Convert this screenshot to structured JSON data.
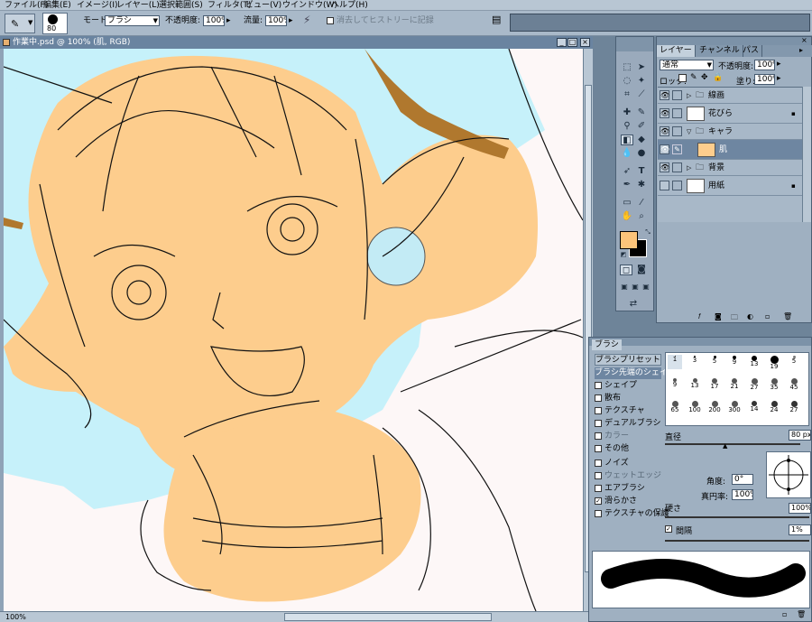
{
  "menu": [
    "ファイル(F)",
    "編集(E)",
    "イメージ(I)",
    "レイヤー(L)",
    "選択範囲(S)",
    "フィルタ(T)",
    "ビュー(V)",
    "ウインドウ(W)",
    "ヘルプ(H)"
  ],
  "options": {
    "brush_size": "80",
    "mode_label": "モード",
    "mode_value": "ブラシ",
    "opacity_label": "不透明度:",
    "opacity_value": "100%",
    "flow_label": "流量:",
    "flow_value": "100%",
    "history_label": "消去してヒストリーに記録"
  },
  "document": {
    "title": "作業中.psd @ 100% (肌, RGB)",
    "min": "_",
    "max": "□",
    "close": "×",
    "status": "100%"
  },
  "layers": {
    "tabs": [
      "レイヤー",
      "チャンネル",
      "パス"
    ],
    "blend_mode": "通常",
    "opacity_label": "不透明度:",
    "opacity_value": "100%",
    "lock_label": "ロック:",
    "fill_label": "塗り:",
    "fill_value": "100%",
    "items": [
      {
        "name": "線画",
        "type": "group"
      },
      {
        "name": "花びら",
        "type": "layer"
      },
      {
        "name": "キャラ",
        "type": "group"
      },
      {
        "name": "肌",
        "type": "layer"
      },
      {
        "name": "背景",
        "type": "group"
      },
      {
        "name": "用紙",
        "type": "layer"
      }
    ]
  },
  "brush": {
    "tab": "ブラシ",
    "items": [
      "ブラシプリセット",
      "ブラシ先端のシェイプ",
      "シェイプ",
      "散布",
      "テクスチャ",
      "デュアルブラシ",
      "カラー",
      "その他",
      "ノイズ",
      "ウェットエッジ",
      "エアブラシ",
      "滑らかさ",
      "テクスチャの保護"
    ],
    "presets_row1": [
      "1",
      "3",
      "5",
      "9",
      "13",
      "19",
      "5"
    ],
    "presets_row2": [
      "9",
      "13",
      "17",
      "21",
      "27",
      "35",
      "45"
    ],
    "presets_row3": [
      "65",
      "100",
      "200",
      "300",
      "14",
      "24",
      "27"
    ],
    "diameter_label": "直径",
    "diameter_value": "80 px",
    "angle_label": "角度:",
    "angle_value": "0°",
    "roundness_label": "真円率:",
    "roundness_value": "100%",
    "hardness_label": "硬さ",
    "hardness_value": "100%",
    "spacing_label": "間隔",
    "spacing_value": "1%"
  },
  "colors": {
    "foreground": "#fcc47a",
    "background": "#000000",
    "accent": "#6a84a0"
  }
}
